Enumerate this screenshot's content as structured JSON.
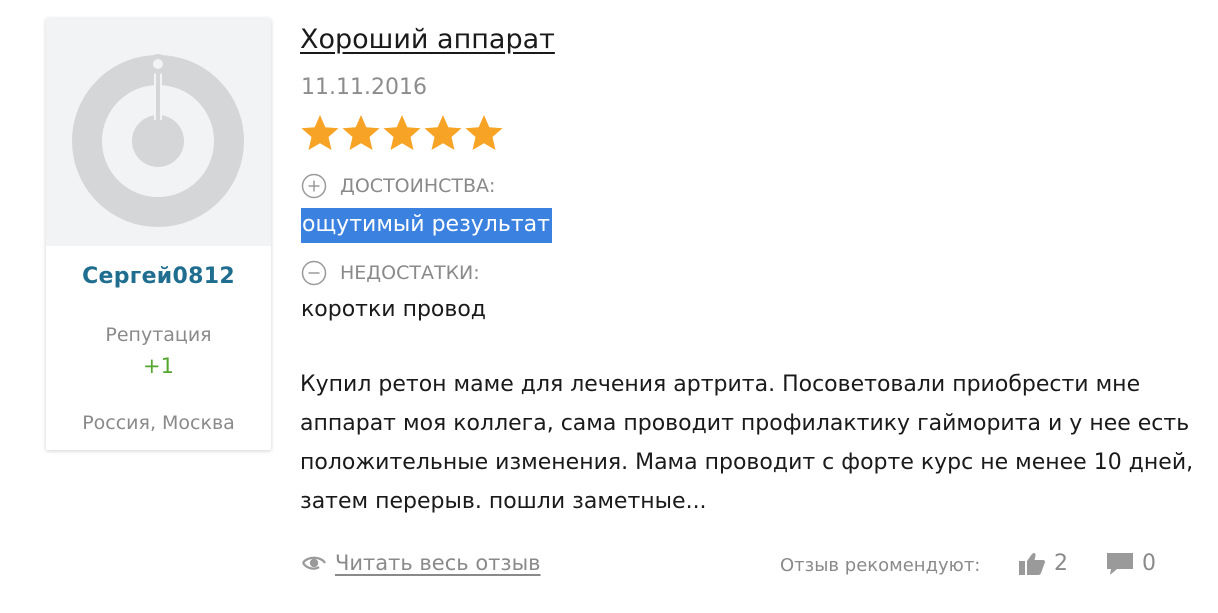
{
  "author": {
    "name": "Сергей0812",
    "reputation_label": "Репутация",
    "reputation_value": "+1",
    "location": "Россия, Москва",
    "avatar_icon": "default-avatar-icon"
  },
  "review": {
    "title": "Хороший аппарат",
    "date": "11.11.2016",
    "rating": 5,
    "rating_max": 5,
    "pros_label": "ДОСТОИНСТВА:",
    "pros_text": "ощутимый результат",
    "cons_label": "НЕДОСТАТКИ:",
    "cons_text": "коротки провод",
    "text": "Купил ретон маме для лечения артрита. Посоветовали приобрести мне аппарат моя коллега, сама проводит профилактику гайморита и у нее есть положительные изменения. Мама проводит с форте курс не менее 10 дней, затем перерыв. пошли заметные..."
  },
  "footer": {
    "read_more": "Читать весь отзыв",
    "recommend_label": "Отзыв рекомендуют:",
    "likes": "2",
    "comments": "0"
  },
  "colors": {
    "author_name": "#1f6d8f",
    "reputation_positive": "#55a630",
    "star": "#f7a325",
    "selection": "#3b82e0",
    "muted": "#8a8a8a"
  }
}
